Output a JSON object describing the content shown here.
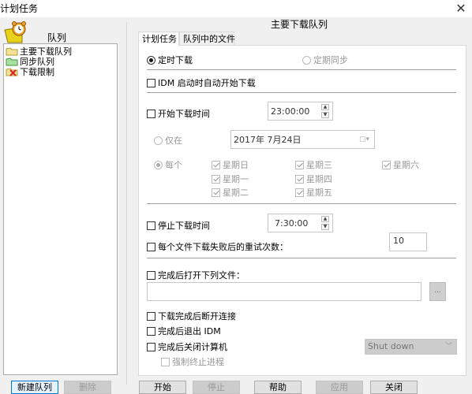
{
  "window": {
    "title": "计划任务",
    "close_icon": "close-icon"
  },
  "queues": {
    "heading": "队列",
    "items": [
      {
        "label": "主要下载队列",
        "icon": "folder-yellow-icon"
      },
      {
        "label": "同步队列",
        "icon": "folder-green-icon"
      },
      {
        "label": "下载限制",
        "icon": "folder-red-x-icon"
      }
    ],
    "new_button": "新建队列",
    "delete_button": "删除"
  },
  "panel": {
    "title": "主要下载队列",
    "tabs": [
      {
        "label": "计划任务",
        "active": true
      },
      {
        "label": "队列中的文件",
        "active": false
      }
    ]
  },
  "schedule": {
    "mode_timed": {
      "label": "定时下载",
      "selected": true
    },
    "mode_periodic": {
      "label": "定期同步",
      "selected": false,
      "disabled": true
    },
    "start_on_idm_launch": {
      "label": "IDM 启动时自动开始下载",
      "checked": false
    },
    "start_time": {
      "label": "开始下载时间",
      "checked": false,
      "value": "23:00:00"
    },
    "only_on": {
      "label": "仅在",
      "selected": false,
      "date": "2017年  7月24日"
    },
    "every": {
      "label": "每个",
      "selected": true
    },
    "weekdays": [
      {
        "label": "星期日",
        "checked": true
      },
      {
        "label": "星期一",
        "checked": true
      },
      {
        "label": "星期二",
        "checked": true
      },
      {
        "label": "星期三",
        "checked": true
      },
      {
        "label": "星期四",
        "checked": true
      },
      {
        "label": "星期五",
        "checked": true
      },
      {
        "label": "星期六",
        "checked": true
      }
    ],
    "stop_time": {
      "label": "停止下载时间",
      "checked": false,
      "value": "7:30:00"
    },
    "retry": {
      "label": "每个文件下载失败后的重试次数：",
      "checked": false,
      "value": "10"
    },
    "open_file": {
      "label": "完成后打开下列文件：",
      "checked": false,
      "path": "",
      "browse_label": "..."
    },
    "hangup": {
      "label": "下载完成后断开连接",
      "checked": false
    },
    "exit_idm": {
      "label": "完成后退出 IDM",
      "checked": false
    },
    "shutdown": {
      "label": "完成后关闭计算机",
      "checked": false,
      "option": "Shut down"
    },
    "force_kill": {
      "label": "强制终止进程",
      "checked": false
    }
  },
  "footer": {
    "start": "开始",
    "stop": "停止",
    "help": "帮助",
    "apply": "应用",
    "close": "关闭"
  }
}
